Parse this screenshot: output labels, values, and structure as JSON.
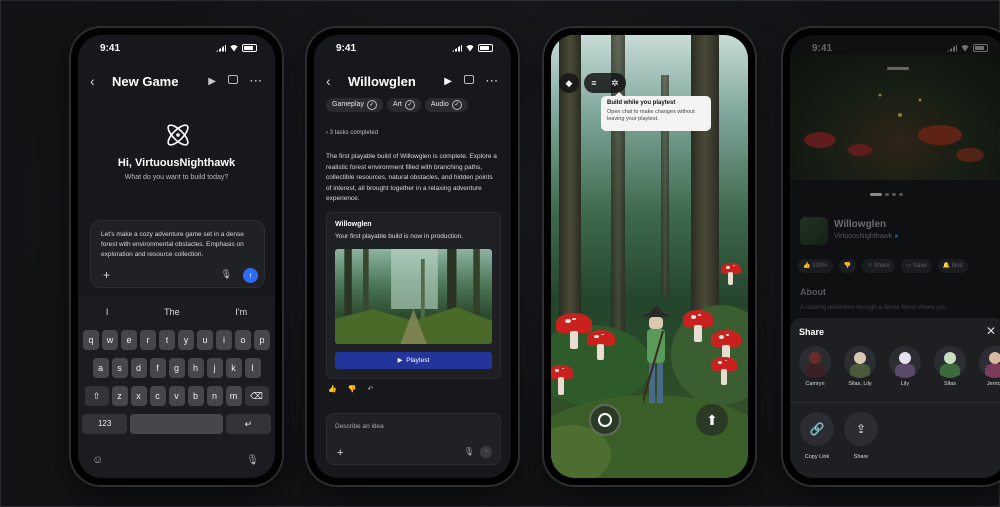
{
  "status": {
    "time": "9:41"
  },
  "phone1": {
    "title": "New Game",
    "greeting": "Hi, VirtuousNighthawk",
    "subtitle": "What do you want to build today?",
    "prompt": "Let's make a cozy adventure game set in a dense forest with environmental obstacles. Emphasis on exploration and resource collection.",
    "suggestions": [
      "I",
      "The",
      "I'm"
    ],
    "keyboard": {
      "row1": [
        "q",
        "w",
        "e",
        "r",
        "t",
        "y",
        "u",
        "i",
        "o",
        "p"
      ],
      "row2": [
        "a",
        "s",
        "d",
        "f",
        "g",
        "h",
        "j",
        "k",
        "l"
      ],
      "row3": [
        "z",
        "x",
        "c",
        "v",
        "b",
        "n",
        "m"
      ],
      "num": "123"
    }
  },
  "phone2": {
    "title": "Willowglen",
    "chips": [
      "Gameplay",
      "Art",
      "Audio"
    ],
    "tasks": "3 tasks completed",
    "summary": "The first playable build of Willowglen is complete. Explore a realistic forest environment filled with branching paths, collectible resources, natural obstacles, and hidden points of interest, all brought together in a relaxing adventure experience.",
    "card_title": "Willowglen",
    "card_subtitle": "Your first playable build is now in production.",
    "playtest": "Playtest",
    "input_placeholder": "Describe an idea"
  },
  "phone3": {
    "tooltip_title": "Build while you playtest",
    "tooltip_desc": "Open chat to make changes without leaving your playtest."
  },
  "phone4": {
    "game_name": "Willowglen",
    "creator": "VirtuousNighthawk",
    "actions": [
      "100%",
      "Share",
      "Save",
      "Noti"
    ],
    "about": "About",
    "about_desc": "A relaxing adventure through a dense forest where you",
    "share_title": "Share",
    "people": [
      {
        "name": "Camryn",
        "head": "#6b2a2a",
        "body": "#3a2222"
      },
      {
        "name": "Silas, Lily",
        "head": "#d9c9b0",
        "body": "#4a5a3a"
      },
      {
        "name": "Lily",
        "head": "#e7e2ee",
        "body": "#5a4a6a"
      },
      {
        "name": "Silas",
        "head": "#c9e0c0",
        "body": "#3c6a3c"
      },
      {
        "name": "Jerrick",
        "head": "#d8b8a0",
        "body": "#7a3c5a"
      }
    ],
    "copy_link": "Copy Link",
    "share": "Share"
  }
}
